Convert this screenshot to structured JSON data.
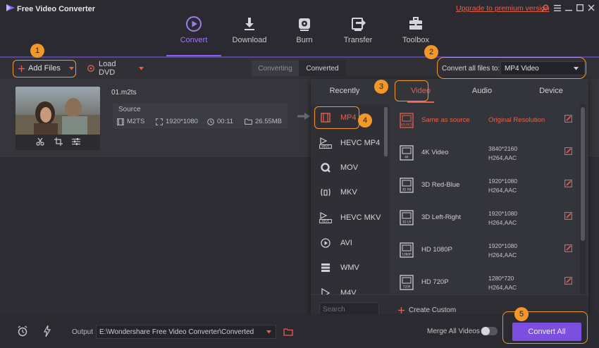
{
  "app": {
    "title": "Free Video Converter",
    "upgrade_link": "Upgrade to premium version"
  },
  "nav": {
    "tabs": [
      {
        "label": "Convert",
        "icon": "convert-icon",
        "active": true
      },
      {
        "label": "Download",
        "icon": "download-icon"
      },
      {
        "label": "Burn",
        "icon": "burn-disc-icon"
      },
      {
        "label": "Transfer",
        "icon": "transfer-icon"
      },
      {
        "label": "Toolbox",
        "icon": "toolbox-icon"
      }
    ]
  },
  "toolbar": {
    "add_files": "Add Files",
    "load_dvd": "Load DVD",
    "converting_tab": "Converting",
    "converted_tab": "Converted",
    "convert_all_to_label": "Convert all files to:",
    "selected_format": "MP4 Video"
  },
  "file": {
    "name": "01.m2ts",
    "source_label": "Source",
    "format": "M2TS",
    "resolution": "1920*1080",
    "duration": "00:11",
    "size": "26.55MB"
  },
  "format_panel": {
    "tabs": [
      "Recently",
      "Video",
      "Audio",
      "Device"
    ],
    "active_tab": "Video",
    "formats": [
      "MP4",
      "HEVC MP4",
      "MOV",
      "MKV",
      "HEVC MKV",
      "AVI",
      "WMV",
      "M4V"
    ],
    "selected_format": "MP4",
    "presets": [
      {
        "name": "Same as source",
        "res": "Original Resolution",
        "codec": "",
        "badge": "SOURCE"
      },
      {
        "name": "4K Video",
        "res": "3840*2160",
        "codec": "H264,AAC",
        "badge": "4K"
      },
      {
        "name": "3D Red-Blue",
        "res": "1920*1080",
        "codec": "H264,AAC",
        "badge": "3D RB"
      },
      {
        "name": "3D Left-Right",
        "res": "1920*1080",
        "codec": "H264,AAC",
        "badge": "3D LR"
      },
      {
        "name": "HD 1080P",
        "res": "1920*1080",
        "codec": "H264,AAC",
        "badge": "1080P"
      },
      {
        "name": "HD 720P",
        "res": "1280*720",
        "codec": "H264,AAC",
        "badge": "720P"
      }
    ],
    "search_placeholder": "Search",
    "create_custom": "Create Custom"
  },
  "bottom": {
    "output_label": "Output",
    "output_path": "E:\\Wondershare Free Video Converter\\Converted",
    "merge_label": "Merge All Videos",
    "convert_all": "Convert All"
  },
  "callouts": [
    "1",
    "2",
    "3",
    "4",
    "5"
  ],
  "colors": {
    "accent_purple": "#7c4fe0",
    "highlight_orange": "#f2982a",
    "active_red": "#e8604c"
  }
}
